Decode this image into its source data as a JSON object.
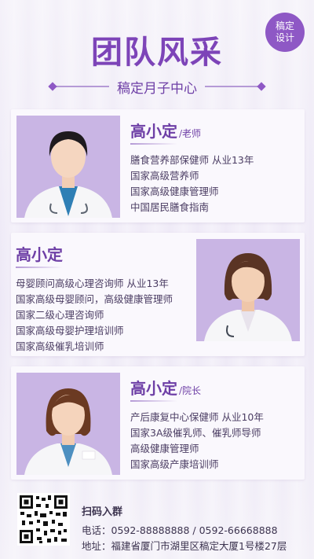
{
  "badge": {
    "line1": "稿定",
    "line2": "设计"
  },
  "header": {
    "title": "团队风采",
    "subtitle": "稿定月子中心"
  },
  "members": [
    {
      "name": "高小定",
      "role": "/老师",
      "lines": [
        "膳食营养部保健师 从业13年",
        "国家高级营养师",
        "国家高级健康管理师",
        "中国居民膳食指南"
      ]
    },
    {
      "name": "高小定",
      "role": "",
      "lines": [
        "母婴顾问高级心理咨询师 从业13年",
        "国家高级母婴顾问，高级健康管理师",
        "国家二级心理咨询师",
        "国家高级母婴护理培训师",
        "国家高级催乳培训师"
      ]
    },
    {
      "name": "高小定",
      "role": "/院长",
      "lines": [
        "产后康复中心保健师 从业10年",
        "国家3A级催乳师、催乳师导师",
        "高级健康管理师",
        "国家高级产康培训师"
      ]
    }
  ],
  "footer": {
    "title": "扫码入群",
    "phone": "电话：0592-88888888 / 0592-66668888",
    "address": "地址：福建省厦门市湖里区稿定大厦1号楼27层"
  },
  "colors": {
    "accent": "#7d44b8",
    "badge": "#8e58c5",
    "photo_bg": "#c9b5e4"
  }
}
